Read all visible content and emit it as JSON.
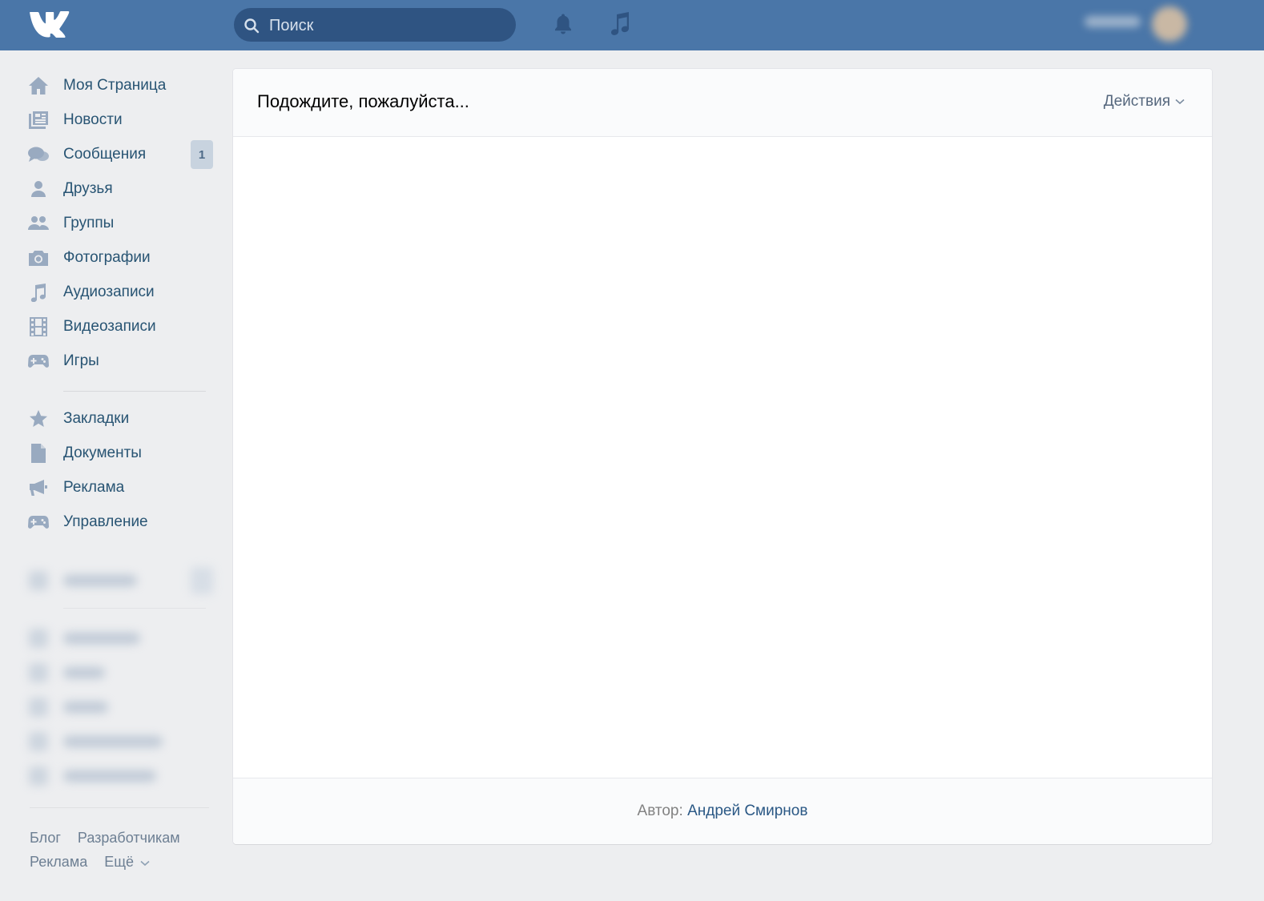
{
  "search": {
    "placeholder": "Поиск"
  },
  "colors": {
    "header": "#4a76a8",
    "search_bg": "#2f5482",
    "link": "#2a5885",
    "sidebar_text": "#285473",
    "page_bg": "#edeef0"
  },
  "sidebar": {
    "items": [
      {
        "label": "Моя Страница",
        "icon": "home-icon"
      },
      {
        "label": "Новости",
        "icon": "news-icon"
      },
      {
        "label": "Сообщения",
        "icon": "messages-icon",
        "badge": "1"
      },
      {
        "label": "Друзья",
        "icon": "friends-icon"
      },
      {
        "label": "Группы",
        "icon": "groups-icon"
      },
      {
        "label": "Фотографии",
        "icon": "camera-icon"
      },
      {
        "label": "Аудиозаписи",
        "icon": "music-icon"
      },
      {
        "label": "Видеозаписи",
        "icon": "video-icon"
      },
      {
        "label": "Игры",
        "icon": "gamepad-icon"
      }
    ],
    "items2": [
      {
        "label": "Закладки",
        "icon": "star-icon"
      },
      {
        "label": "Документы",
        "icon": "document-icon"
      },
      {
        "label": "Реклама",
        "icon": "megaphone-icon"
      },
      {
        "label": "Управление",
        "icon": "gamepad-icon"
      }
    ],
    "footer": {
      "blog": "Блог",
      "developers": "Разработчикам",
      "ads": "Реклама",
      "more": "Ещё"
    }
  },
  "main": {
    "title": "Подождите, пожалуйста...",
    "actions_label": "Действия",
    "author_label": "Автор:",
    "author_name": "Андрей Смирнов"
  }
}
